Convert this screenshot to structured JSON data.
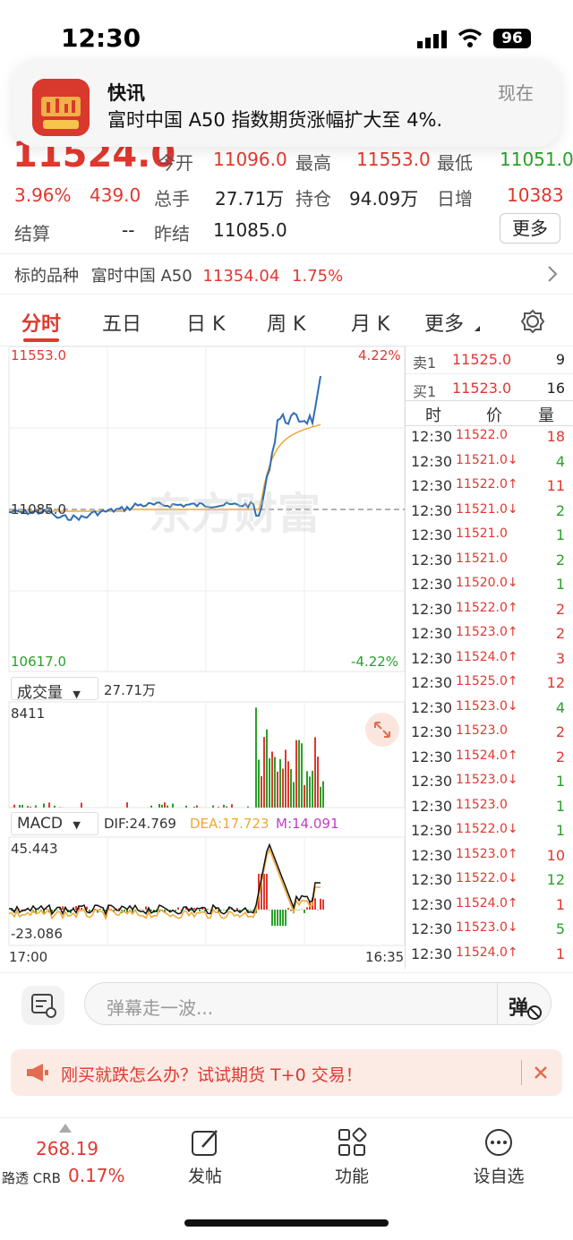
{
  "status": {
    "time": "12:30",
    "battery": "96"
  },
  "notification": {
    "app": "快讯",
    "time": "现在",
    "body": "富时中国 A50 指数期货涨幅扩大至 4%."
  },
  "quote": {
    "price": "11524.0",
    "change_pct": "3.96%",
    "change": "439.0",
    "open_label": "今开",
    "open": "11096.0",
    "high_label": "最高",
    "high": "11553.0",
    "low_label": "最低",
    "low": "11051.0",
    "volume_label": "总手",
    "volume": "27.71万",
    "oi_label": "持仓",
    "oi": "94.09万",
    "daily_inc_label": "日增",
    "daily_inc": "10383",
    "settle_label": "结算",
    "settle": "--",
    "prev_settle_label": "昨结",
    "prev_settle": "11085.0",
    "more_label": "更多"
  },
  "underlying": {
    "label": "标的品种",
    "name": "富时中国 A50",
    "price": "11354.04",
    "pct": "1.75%"
  },
  "tabs": [
    "分时",
    "五日",
    "日 K",
    "周 K",
    "月 K",
    "更多"
  ],
  "chart": {
    "top_price": "11553.0",
    "top_pct": "4.22%",
    "mid_price": "11085.0",
    "bottom_price": "10617.0",
    "bottom_pct": "-4.22%",
    "watermark": "东方财富",
    "volume_dropdown": "成交量",
    "volume_total": "27.71万",
    "volume_max": "8411",
    "macd_dropdown": "MACD",
    "dif": "DIF:24.769",
    "dea": "DEA:17.723",
    "m": "M:14.091",
    "macd_top": "45.443",
    "macd_bottom": "-23.086",
    "time_start": "17:00",
    "time_end": "16:35"
  },
  "orderbook": {
    "sell_label": "卖1",
    "sell_price": "11525.0",
    "sell_vol": "9",
    "buy_label": "买1",
    "buy_price": "11523.0",
    "buy_vol": "16",
    "col_time": "时",
    "col_price": "价",
    "col_vol": "量"
  },
  "ticks": [
    {
      "time": "12:30",
      "price": "11522.0",
      "vol": "18",
      "dir": ""
    },
    {
      "time": "12:30",
      "price": "11521.0↓",
      "vol": "4",
      "dir": "down"
    },
    {
      "time": "12:30",
      "price": "11522.0↑",
      "vol": "11",
      "dir": "up"
    },
    {
      "time": "12:30",
      "price": "11521.0↓",
      "vol": "2",
      "dir": "down"
    },
    {
      "time": "12:30",
      "price": "11521.0",
      "vol": "1",
      "dir": "down"
    },
    {
      "time": "12:30",
      "price": "11521.0",
      "vol": "2",
      "dir": "down"
    },
    {
      "time": "12:30",
      "price": "11520.0↓",
      "vol": "1",
      "dir": "down"
    },
    {
      "time": "12:30",
      "price": "11522.0↑",
      "vol": "2",
      "dir": "up"
    },
    {
      "time": "12:30",
      "price": "11523.0↑",
      "vol": "2",
      "dir": "up"
    },
    {
      "time": "12:30",
      "price": "11524.0↑",
      "vol": "3",
      "dir": "up"
    },
    {
      "time": "12:30",
      "price": "11525.0↑",
      "vol": "12",
      "dir": "up"
    },
    {
      "time": "12:30",
      "price": "11523.0↓",
      "vol": "4",
      "dir": "down"
    },
    {
      "time": "12:30",
      "price": "11523.0",
      "vol": "2",
      "dir": "up"
    },
    {
      "time": "12:30",
      "price": "11524.0↑",
      "vol": "2",
      "dir": "up"
    },
    {
      "time": "12:30",
      "price": "11523.0↓",
      "vol": "1",
      "dir": "down"
    },
    {
      "time": "12:30",
      "price": "11523.0",
      "vol": "1",
      "dir": "down"
    },
    {
      "time": "12:30",
      "price": "11522.0↓",
      "vol": "1",
      "dir": "down"
    },
    {
      "time": "12:30",
      "price": "11523.0↑",
      "vol": "10",
      "dir": "up"
    },
    {
      "time": "12:30",
      "price": "11522.0↓",
      "vol": "12",
      "dir": "down"
    },
    {
      "time": "12:30",
      "price": "11524.0↑",
      "vol": "1",
      "dir": "up"
    },
    {
      "time": "12:30",
      "price": "11523.0↓",
      "vol": "5",
      "dir": "down"
    },
    {
      "time": "12:30",
      "price": "11524.0↑",
      "vol": "1",
      "dir": "up"
    }
  ],
  "input": {
    "placeholder": "弹幕走一波...",
    "button": "弹"
  },
  "promo": {
    "text": "刚买就跌怎么办？试试期货 T+0 交易！"
  },
  "bottom": {
    "crb_value": "268.19",
    "crb_label": "路透 CRB",
    "crb_pct": "0.17%",
    "post": "发帖",
    "func": "功能",
    "watch": "设自选"
  },
  "colors": {
    "up": "#e0382f",
    "down": "#2aa02a",
    "price_line": "#2f6db5",
    "avg_line": "#f0a830"
  }
}
